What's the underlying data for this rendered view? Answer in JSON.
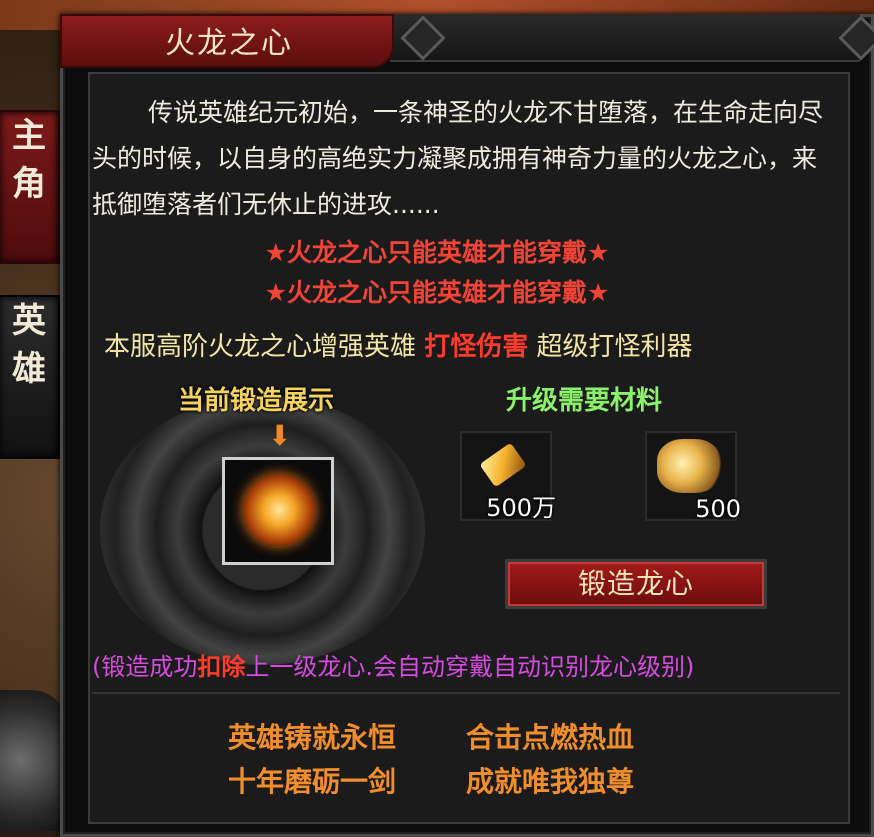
{
  "side_tabs": [
    {
      "label_top": "主",
      "label_bottom": "角"
    },
    {
      "label_top": "英",
      "label_bottom": "雄"
    }
  ],
  "panel": {
    "title": "火龙之心",
    "description": "传说英雄纪元初始，一条神圣的火龙不甘堕落，在生命走向尽头的时候，以自身的高绝实力凝聚成拥有神奇力量的火龙之心，来抵御堕落者们无休止的进攻......",
    "notice_1": "★火龙之心只能英雄才能穿戴★",
    "notice_2": "★火龙之心只能英雄才能穿戴★",
    "promo": {
      "prefix": "本服高阶火龙之心增强英雄 ",
      "highlight": "打怪伤害",
      "suffix": " 超级打怪利器"
    }
  },
  "forge": {
    "display_label": "当前锻造展示",
    "arrow": "⬇",
    "materials_title": "升级需要材料",
    "materials": [
      {
        "icon": "gold-ingot-icon",
        "quantity": "500万"
      },
      {
        "icon": "dragon-material-icon",
        "quantity": "500"
      }
    ],
    "button_label": "锻造龙心"
  },
  "rule": {
    "part1": "(锻造成功",
    "highlight": "扣除",
    "part2": "上一级龙心.会自动穿戴自动识别龙心级别)"
  },
  "mottos": [
    "英雄铸就永恒",
    "合击点燃热血",
    "十年磨砺一剑",
    "成就唯我独尊"
  ],
  "colors": {
    "notice": "#f24436",
    "promo": "#f4e7a6",
    "highlight": "#ff3b2b",
    "materials_title": "#8bf26b",
    "forge_label": "#f6d35c",
    "rule": "#d64be0",
    "motto": "#f08d2c"
  }
}
